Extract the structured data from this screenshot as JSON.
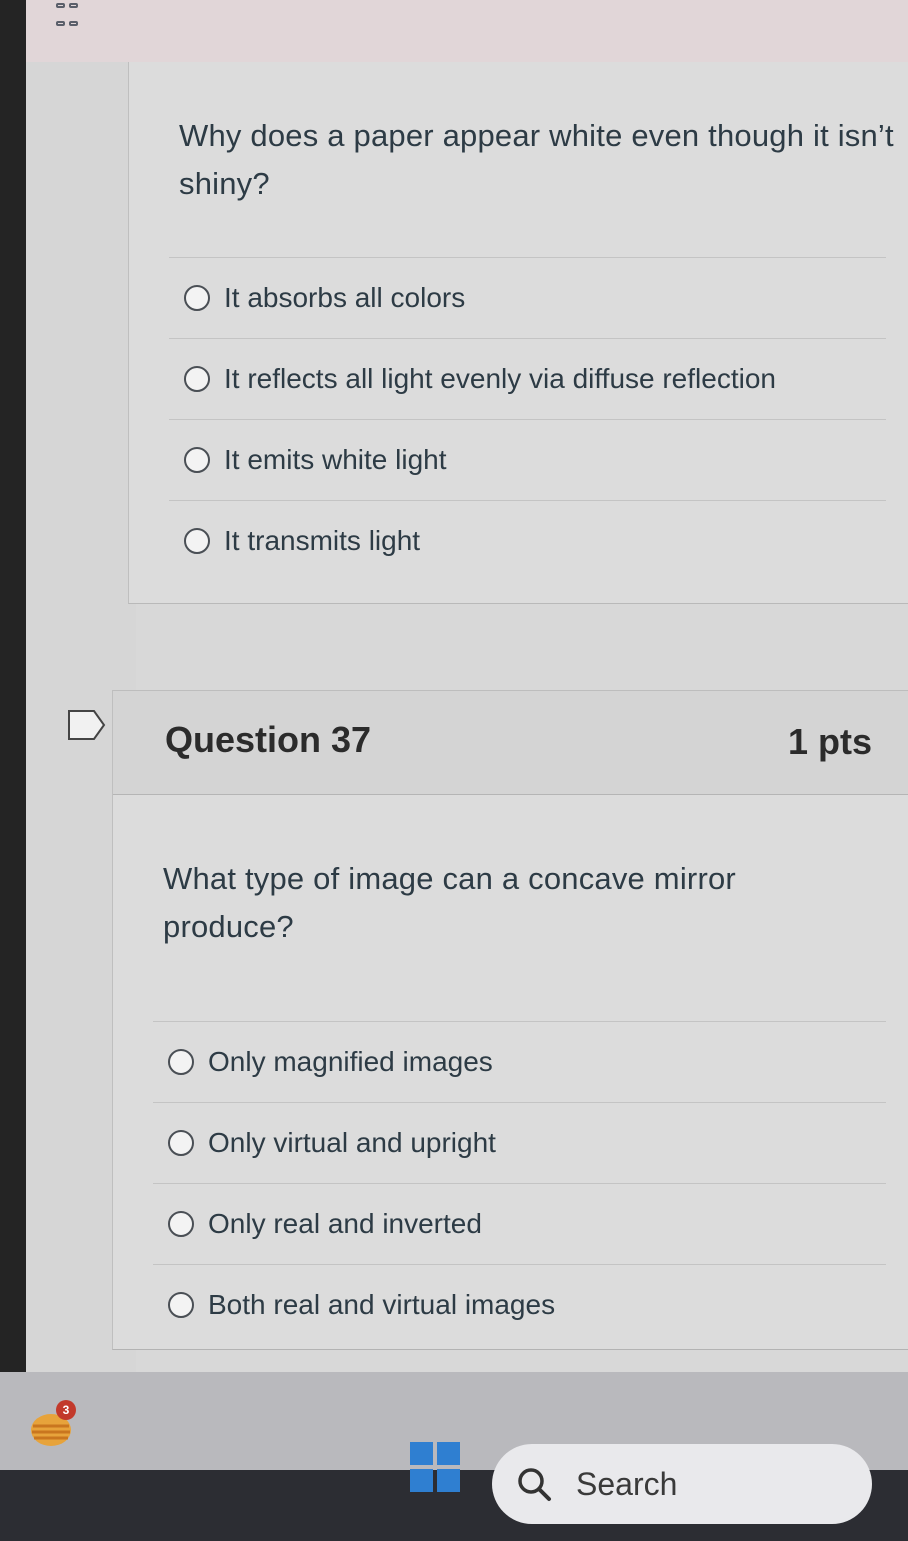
{
  "previous_question": {
    "text": "Why does a paper appear white even though it isn’t shiny?",
    "answers": [
      "It absorbs all colors",
      "It reflects all light evenly via diffuse reflection",
      "It emits white light",
      "It transmits light"
    ]
  },
  "question": {
    "title": "Question 37",
    "points": "1 pts",
    "text": "What type of image can a concave mirror produce?",
    "answers": [
      "Only magnified images",
      "Only virtual and upright",
      "Only real and inverted",
      "Both real and virtual images"
    ]
  },
  "taskbar": {
    "notification_count": "3",
    "search_label": "Search"
  },
  "colors": {
    "text": "#2d3b45",
    "start_blue": "#2f7fd1",
    "badge_red": "#c2392b"
  }
}
